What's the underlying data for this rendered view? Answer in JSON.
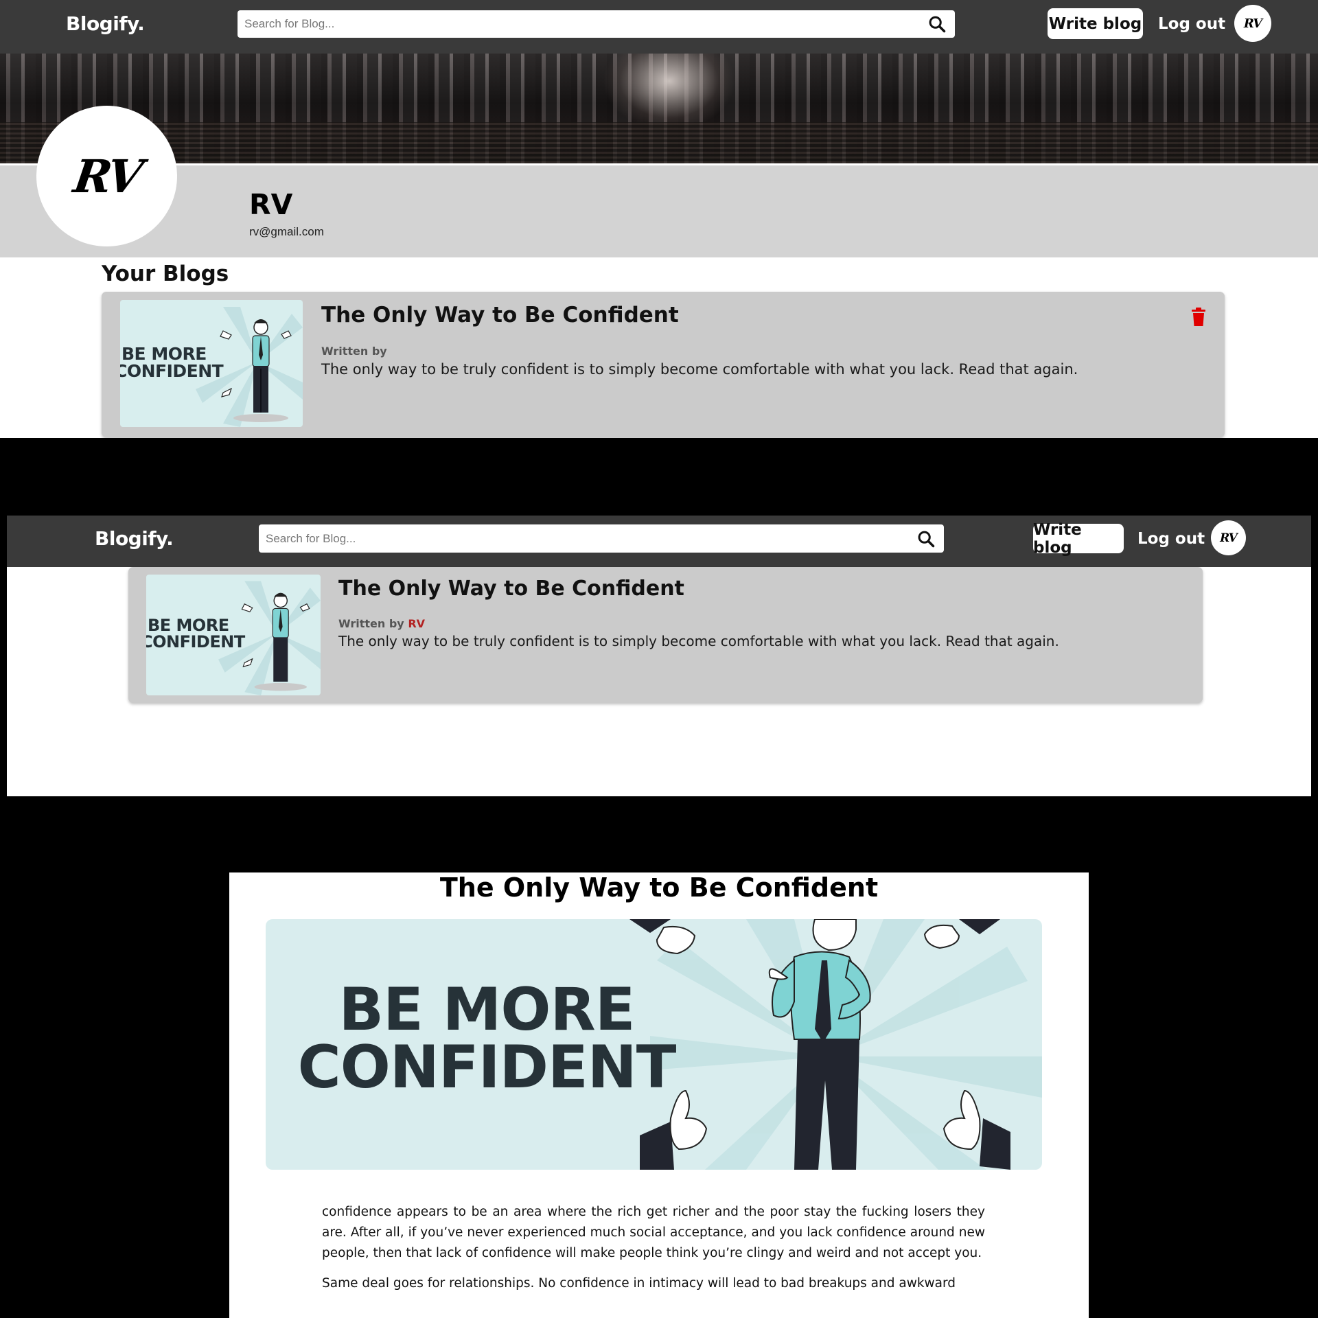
{
  "navbar": {
    "brand": "Blogify.",
    "search_placeholder": "Search for Blog...",
    "write_label": "Write blog",
    "logout_label": "Log out",
    "avatar_initials": "RV"
  },
  "profile": {
    "avatar_initials": "RV",
    "name": "RV",
    "email": "rv@gmail.com",
    "section_title": "Your Blogs"
  },
  "blog": {
    "title": "The Only Way to Be Confident",
    "written_by": "Written by",
    "author": "RV",
    "excerpt": "The only way to be truly confident is to simply become comfortable with what you lack. Read that again.",
    "thumb_line1": "BE MORE",
    "thumb_line2": "CONFIDENT"
  },
  "article": {
    "title": "The Only Way to Be Confident",
    "hero_line1": "BE MORE",
    "hero_line2": "CONFIDENT",
    "paragraphs": [
      "confidence appears to be an area where the rich get richer and the poor stay the fucking losers they are. After all, if you’ve never experienced much social acceptance, and you lack confidence around new people, then that lack of confidence will make people think you’re clingy and weird and not accept you.",
      "Same deal goes for relationships. No confidence in intimacy will lead to bad breakups and awkward"
    ]
  },
  "colors": {
    "navbar_bg": "#3a3a3a",
    "card_bg": "#cbcbcb",
    "profile_band": "#d3d3d3",
    "thumb_bg": "#d8eeee",
    "delete_red": "#e00000",
    "author_red": "#b22222"
  },
  "icons": [
    "search-icon",
    "trash-icon",
    "avatar-logo"
  ]
}
